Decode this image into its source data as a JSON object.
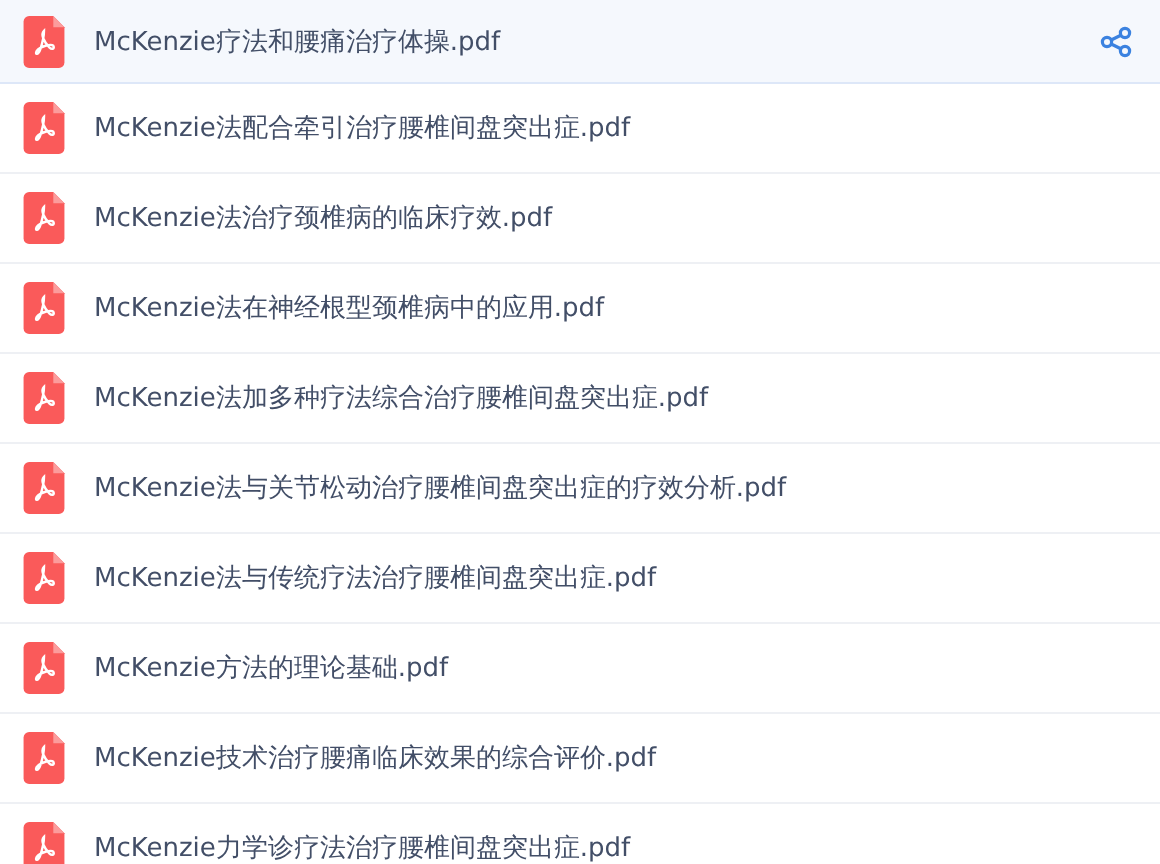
{
  "files": [
    {
      "name": "McKenzie疗法和腰痛治疗体操.pdf",
      "selected": true
    },
    {
      "name": "McKenzie法配合牵引治疗腰椎间盘突出症.pdf",
      "selected": false
    },
    {
      "name": "McKenzie法治疗颈椎病的临床疗效.pdf",
      "selected": false
    },
    {
      "name": "McKenzie法在神经根型颈椎病中的应用.pdf",
      "selected": false
    },
    {
      "name": "McKenzie法加多种疗法综合治疗腰椎间盘突出症.pdf",
      "selected": false
    },
    {
      "name": "McKenzie法与关节松动治疗腰椎间盘突出症的疗效分析.pdf",
      "selected": false
    },
    {
      "name": "McKenzie法与传统疗法治疗腰椎间盘突出症.pdf",
      "selected": false
    },
    {
      "name": "McKenzie方法的理论基础.pdf",
      "selected": false
    },
    {
      "name": "McKenzie技术治疗腰痛临床效果的综合评价.pdf",
      "selected": false
    },
    {
      "name": "McKenzie力学诊疗法治疗腰椎间盘突出症.pdf",
      "selected": false
    }
  ]
}
